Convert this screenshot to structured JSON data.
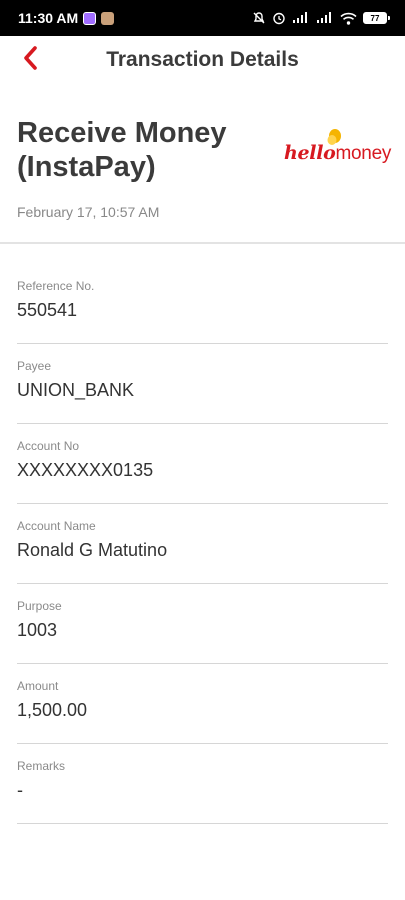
{
  "status_bar": {
    "time": "11:30 AM",
    "battery": "77",
    "icons": [
      "messenger-icon",
      "photo-icon",
      "mute-icon",
      "alarm-icon",
      "signal-icon",
      "signal-icon",
      "wifi-icon",
      "battery-icon"
    ]
  },
  "header": {
    "title": "Transaction Details",
    "back_icon": "chevron-left-icon",
    "accent_color": "#d71920"
  },
  "summary": {
    "type": "Receive Money (InstaPay)",
    "date": "February 17, 10:57 AM",
    "logo_hello": "hello",
    "logo_money": "money"
  },
  "details": [
    {
      "label": "Reference No.",
      "value": "550541"
    },
    {
      "label": "Payee",
      "value": "UNION_BANK"
    },
    {
      "label": "Account No",
      "value": "XXXXXXXX0135"
    },
    {
      "label": "Account Name",
      "value": "Ronald G Matutino"
    },
    {
      "label": "Purpose",
      "value": "1003"
    },
    {
      "label": "Amount",
      "value": "1,500.00"
    },
    {
      "label": "Remarks",
      "value": "-"
    }
  ]
}
